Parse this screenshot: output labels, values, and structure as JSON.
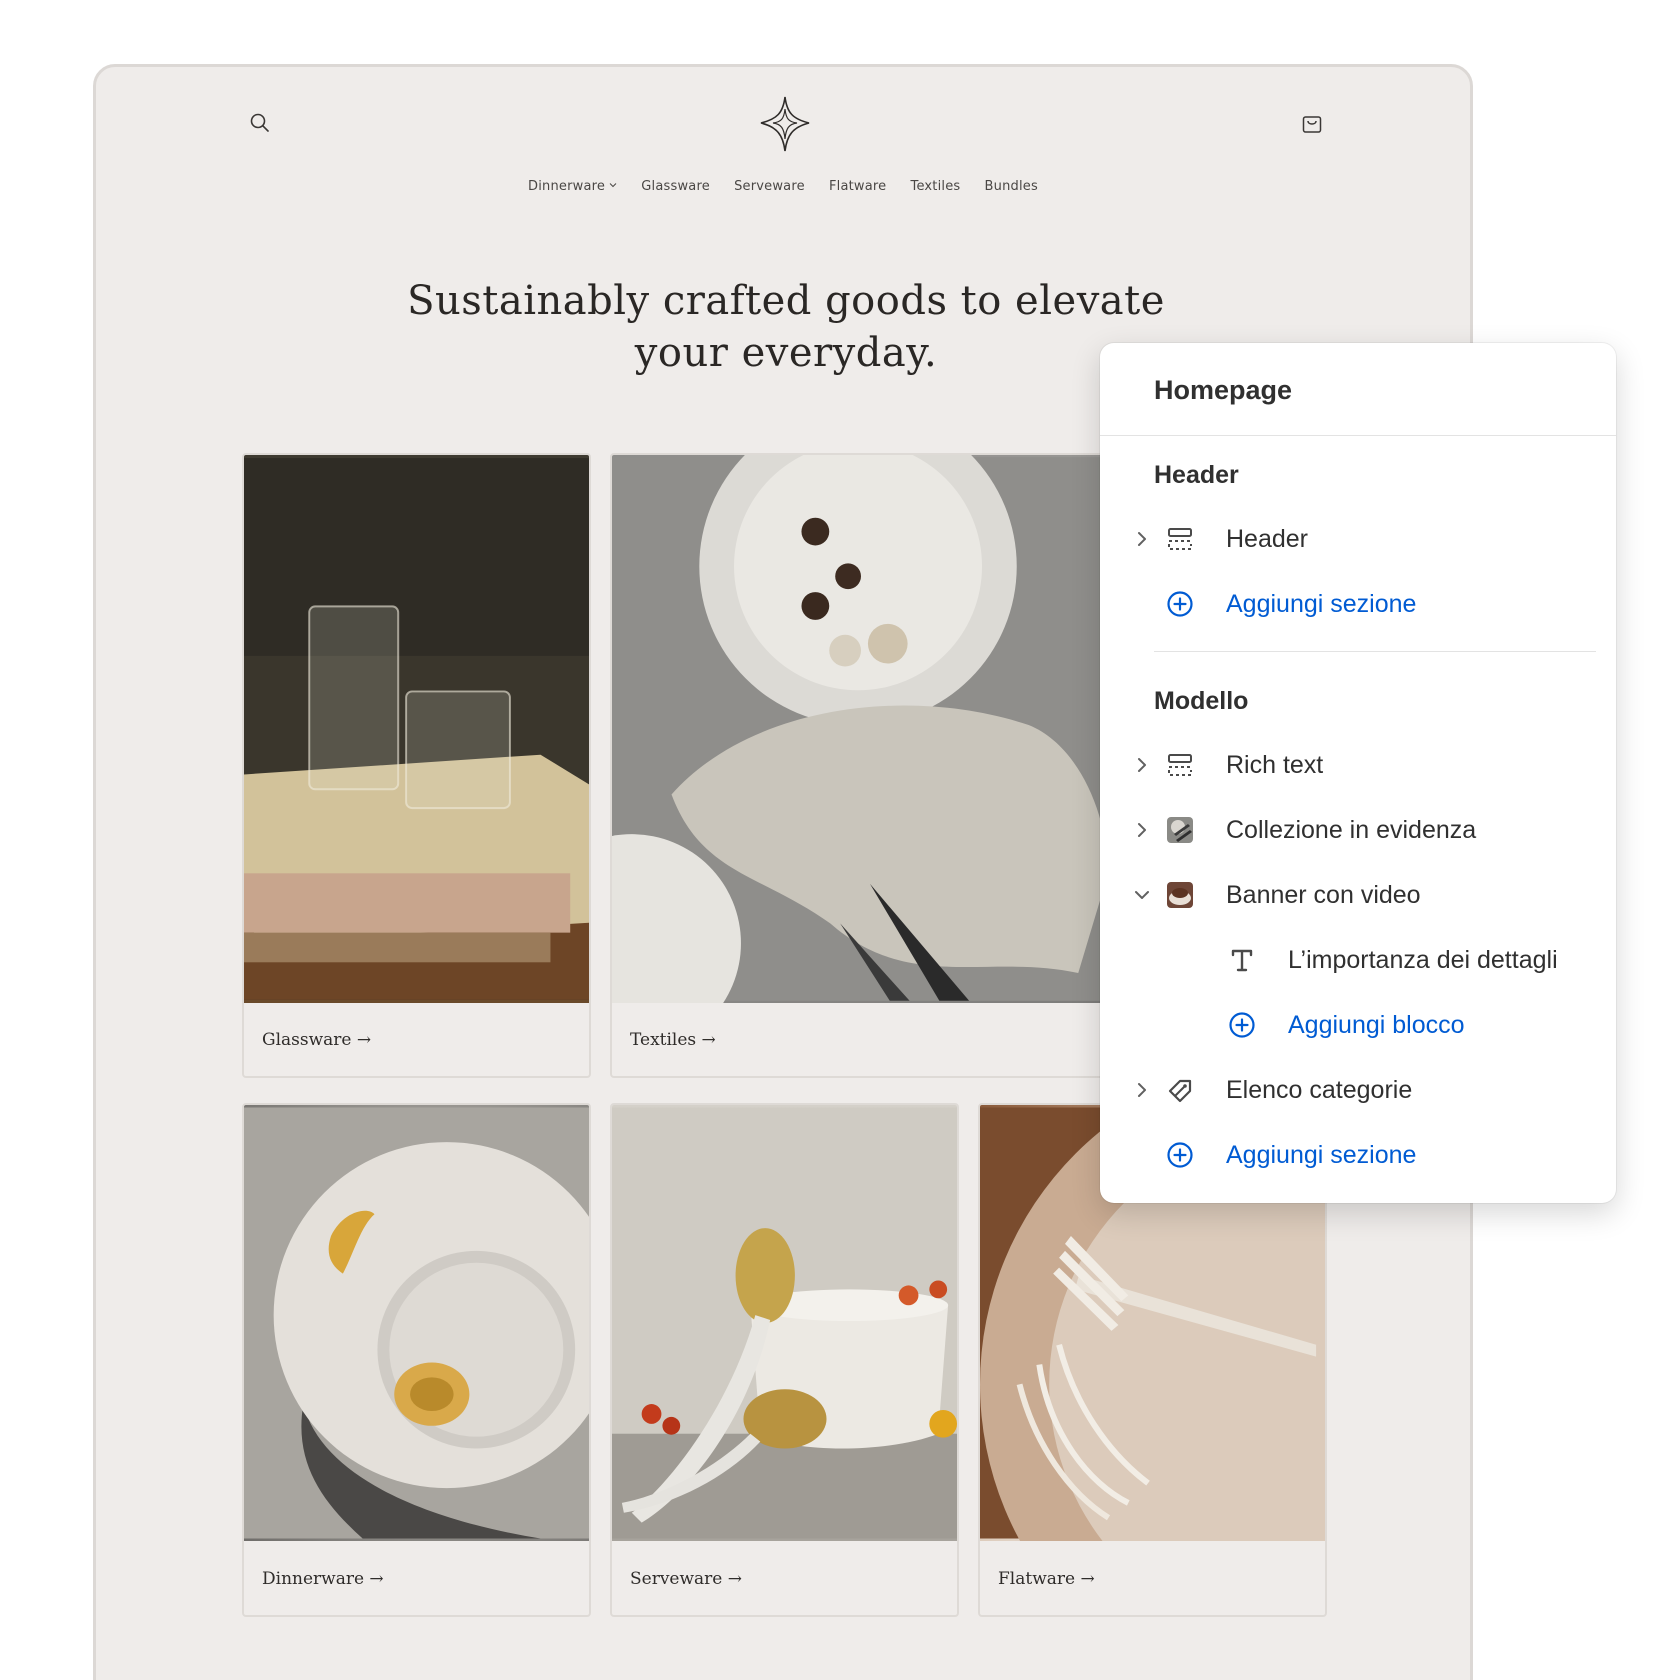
{
  "store": {
    "nav": [
      "Dinnerware",
      "Glassware",
      "Serveware",
      "Flatware",
      "Textiles",
      "Bundles"
    ],
    "hero_line1": "Sustainably crafted goods to elevate",
    "hero_line2": "your everyday.",
    "cards": [
      {
        "label": "Glassware →"
      },
      {
        "label": "Textiles →"
      },
      {
        "label": "Dinnerware →"
      },
      {
        "label": "Serveware →"
      },
      {
        "label": "Flatware →"
      }
    ]
  },
  "panel": {
    "title": "Homepage",
    "header_group": "Header",
    "header_item": "Header",
    "add_section_1": "Aggiungi sezione",
    "template_group": "Modello",
    "rich_text": "Rich text",
    "featured_collection": "Collezione in evidenza",
    "video_banner": "Banner con video",
    "video_block": "L’importanza dei dettagli",
    "add_block": "Aggiungi blocco",
    "category_list": "Elenco categorie",
    "add_section_2": "Aggiungi sezione"
  },
  "colors": {
    "accent": "#005bd3",
    "store_bg": "#efecea",
    "panel_text": "#303030"
  },
  "icons": [
    "search-icon",
    "brand-logo-icon",
    "cart-icon",
    "chevron-right-icon",
    "chevron-down-icon",
    "section-icon",
    "plus-circle-icon",
    "text-icon",
    "tag-icon"
  ]
}
